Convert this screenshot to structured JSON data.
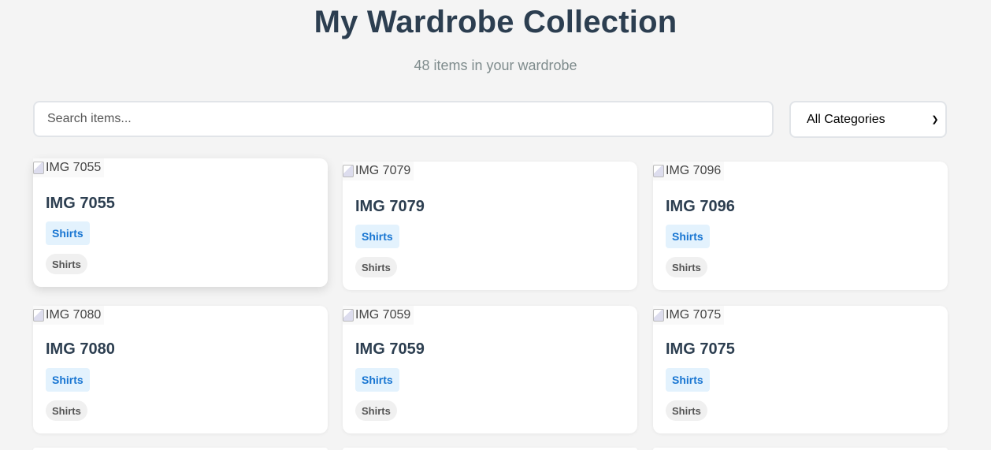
{
  "header": {
    "title": "My Wardrobe Collection",
    "subtitle": "48 items in your wardrobe"
  },
  "search": {
    "placeholder": "Search items...",
    "value": ""
  },
  "category_filter": {
    "selected": "All Categories"
  },
  "items": [
    {
      "image_alt": "IMG 7055",
      "name": "IMG 7055",
      "category": "Shirts",
      "tag": "Shirts"
    },
    {
      "image_alt": "IMG 7079",
      "name": "IMG 7079",
      "category": "Shirts",
      "tag": "Shirts"
    },
    {
      "image_alt": "IMG 7096",
      "name": "IMG 7096",
      "category": "Shirts",
      "tag": "Shirts"
    },
    {
      "image_alt": "IMG 7080",
      "name": "IMG 7080",
      "category": "Shirts",
      "tag": "Shirts"
    },
    {
      "image_alt": "IMG 7059",
      "name": "IMG 7059",
      "category": "Shirts",
      "tag": "Shirts"
    },
    {
      "image_alt": "IMG 7075",
      "name": "IMG 7075",
      "category": "Shirts",
      "tag": "Shirts"
    }
  ],
  "colors": {
    "background": "#f4f4f4",
    "heading": "#2c3e50",
    "category_tag_bg": "#e3f2fd",
    "category_tag_text": "#1976d2"
  }
}
